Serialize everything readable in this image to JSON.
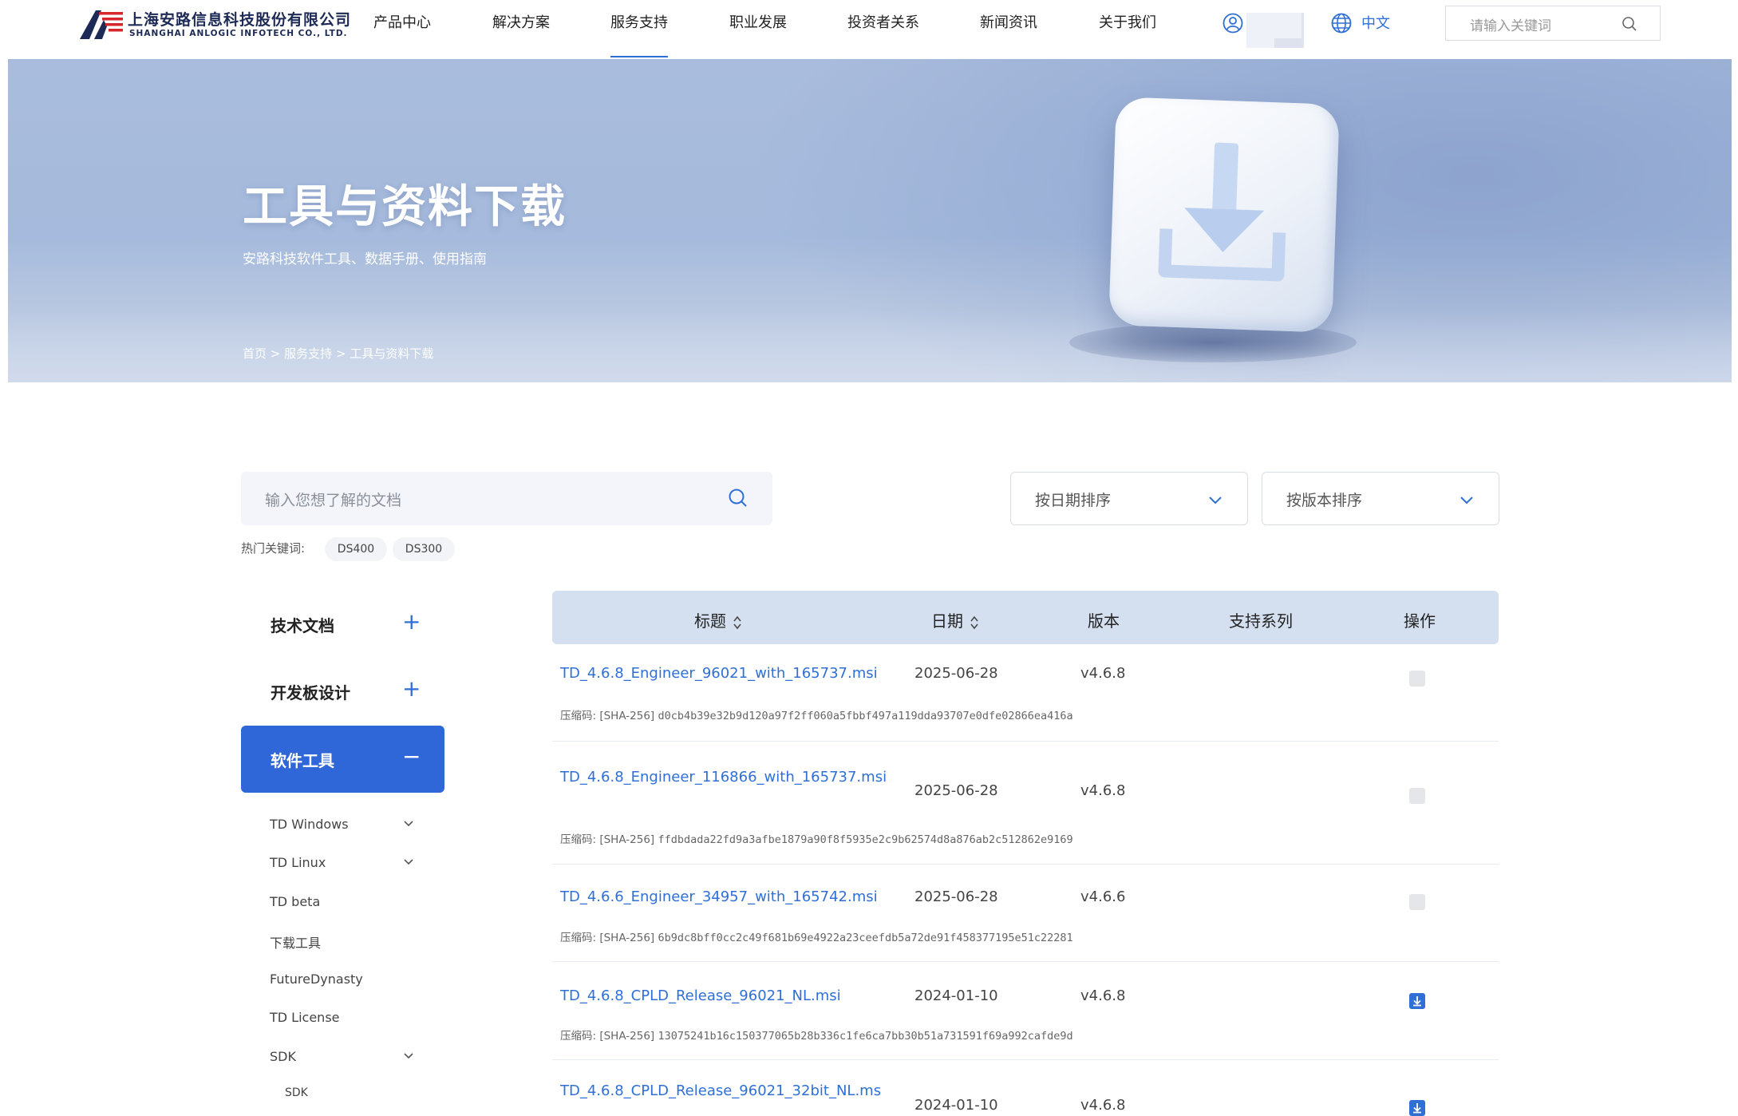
{
  "header": {
    "logo_cn": "上海安路信息科技股份有限公司",
    "logo_en": "SHANGHAI ANLOGIC INFOTECH CO., LTD.",
    "nav": [
      "产品中心",
      "解决方案",
      "服务支持",
      "职业发展",
      "投资者关系",
      "新闻资讯",
      "关于我们"
    ],
    "active_nav": "服务支持",
    "language": "中文",
    "search_placeholder": "请输入关键词",
    "brand_colors": {
      "red": "#d6252b",
      "navy": "#1c2a55"
    }
  },
  "banner": {
    "title": "工具与资料下载",
    "subtitle": "安路科技软件工具、数据手册、使用指南",
    "breadcrumb": [
      "首页",
      ">",
      "服务支持",
      ">",
      "工具与资料下载"
    ]
  },
  "filters": {
    "doc_search_placeholder": "输入您想了解的文档",
    "hot_label": "热门关键词:",
    "hot_keywords": [
      "DS400",
      "DS300"
    ],
    "sort_date": "按日期排序",
    "sort_version": "按版本排序"
  },
  "sidebar": {
    "categories": [
      {
        "label": "技术文档",
        "sign": "+"
      },
      {
        "label": "开发板设计",
        "sign": "+"
      },
      {
        "label": "软件工具",
        "sign": "−",
        "active": true
      }
    ],
    "subitems": [
      "TD Windows",
      "TD Linux",
      "TD beta",
      "下载工具",
      "FutureDynasty",
      "TD License",
      "SDK"
    ],
    "subsub": [
      "SDK"
    ]
  },
  "table": {
    "headers": {
      "title": "标题",
      "date": "日期",
      "version": "版本",
      "series": "支持系列",
      "action": "操作"
    },
    "hash_prefix": "压缩码: [SHA-256]",
    "rows": [
      {
        "title": "TD_4.6.8_Engineer_96021_with_165737.msi",
        "date": "2025-06-28",
        "version": "v4.6.8",
        "hash": "d0cb4b39e32b9d120a97f2ff060a5fbbf497a119dda93707e0dfe02866ea416a",
        "downloadable": false
      },
      {
        "title": "TD_4.6.8_Engineer_116866_with_165737.msi",
        "date": "2025-06-28",
        "version": "v4.6.8",
        "hash": "ffdbdada22fd9a3afbe1879a90f8f5935e2c9b62574d8a876ab2c512862e9169",
        "downloadable": false
      },
      {
        "title": "TD_4.6.6_Engineer_34957_with_165742.msi",
        "date": "2025-06-28",
        "version": "v4.6.6",
        "hash": "6b9dc8bff0cc2c49f681b69e4922a23ceefdb5a72de91f458377195e51c22281",
        "downloadable": false
      },
      {
        "title": "TD_4.6.8_CPLD_Release_96021_NL.msi",
        "date": "2024-01-10",
        "version": "v4.6.8",
        "hash": "13075241b16c150377065b28b336c1fe6ca7bb30b51a731591f69a992cafde9d",
        "downloadable": true
      },
      {
        "title": "TD_4.6.8_CPLD_Release_96021_32bit_NL.ms",
        "date": "2024-01-10",
        "version": "v4.6.8",
        "hash": "",
        "downloadable": true
      }
    ]
  }
}
